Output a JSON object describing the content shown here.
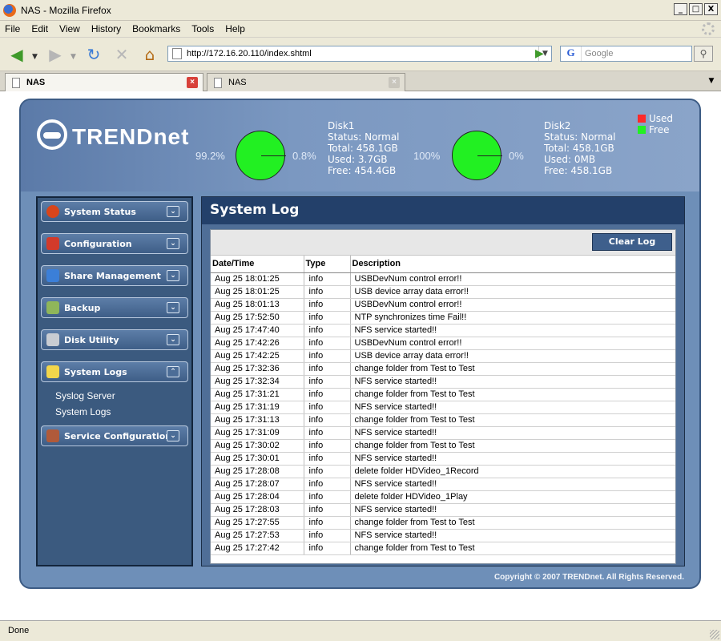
{
  "window": {
    "title": "NAS - Mozilla Firefox",
    "min": "_",
    "max": "□",
    "close": "X"
  },
  "menu": [
    "File",
    "Edit",
    "View",
    "History",
    "Bookmarks",
    "Tools",
    "Help"
  ],
  "nav": {
    "url": "http://172.16.20.110/index.shtml",
    "search_placeholder": "Google",
    "search_engine_letter": "G"
  },
  "tabs": [
    {
      "label": "NAS"
    },
    {
      "label": "NAS"
    }
  ],
  "brand": {
    "logo": "TRENDnet"
  },
  "disks": [
    {
      "name": "Disk1",
      "status": "Status: Normal",
      "total": "Total: 458.1GB",
      "used": "Used: 3.7GB",
      "free": "Free: 454.4GB",
      "free_pct": "99.2%",
      "used_pct": "0.8%"
    },
    {
      "name": "Disk2",
      "status": "Status: Normal",
      "total": "Total: 458.1GB",
      "used": "Used: 0MB",
      "free": "Free: 458.1GB",
      "free_pct": "100%",
      "used_pct": "0%"
    }
  ],
  "legend": {
    "used": "Used",
    "free": "Free",
    "used_color": "#ff2a2a",
    "free_color": "#22f022"
  },
  "sidebar": {
    "items": [
      {
        "label": "System Status"
      },
      {
        "label": "Configuration"
      },
      {
        "label": "Share Management"
      },
      {
        "label": "Backup"
      },
      {
        "label": "Disk Utility"
      },
      {
        "label": "System Logs"
      },
      {
        "label": "Service Configuration"
      }
    ],
    "sub_items": [
      {
        "label": "Syslog Server"
      },
      {
        "label": "System Logs"
      }
    ]
  },
  "main": {
    "title": "System Log",
    "clear_button": "Clear Log",
    "columns": [
      "Date/Time",
      "Type",
      "Description"
    ],
    "rows": [
      [
        "Aug 25 18:01:25",
        "info",
        "USBDevNum control error!!"
      ],
      [
        "Aug 25 18:01:25",
        "info",
        "USB device array data error!!"
      ],
      [
        "Aug 25 18:01:13",
        "info",
        "USBDevNum control error!!"
      ],
      [
        "Aug 25 17:52:50",
        "info",
        "NTP synchronizes time Fail!!"
      ],
      [
        "Aug 25 17:47:40",
        "info",
        "NFS service started!!"
      ],
      [
        "Aug 25 17:42:26",
        "info",
        "USBDevNum control error!!"
      ],
      [
        "Aug 25 17:42:25",
        "info",
        "USB device array data error!!"
      ],
      [
        "Aug 25 17:32:36",
        "info",
        "change folder from Test to Test"
      ],
      [
        "Aug 25 17:32:34",
        "info",
        "NFS service started!!"
      ],
      [
        "Aug 25 17:31:21",
        "info",
        "change folder from Test to Test"
      ],
      [
        "Aug 25 17:31:19",
        "info",
        "NFS service started!!"
      ],
      [
        "Aug 25 17:31:13",
        "info",
        "change folder from Test to Test"
      ],
      [
        "Aug 25 17:31:09",
        "info",
        "NFS service started!!"
      ],
      [
        "Aug 25 17:30:02",
        "info",
        "change folder from Test to Test"
      ],
      [
        "Aug 25 17:30:01",
        "info",
        "NFS service started!!"
      ],
      [
        "Aug 25 17:28:08",
        "info",
        "delete folder HDVideo_1Record"
      ],
      [
        "Aug 25 17:28:07",
        "info",
        "NFS service started!!"
      ],
      [
        "Aug 25 17:28:04",
        "info",
        "delete folder HDVideo_1Play"
      ],
      [
        "Aug 25 17:28:03",
        "info",
        "NFS service started!!"
      ],
      [
        "Aug 25 17:27:55",
        "info",
        "change folder from Test to Test"
      ],
      [
        "Aug 25 17:27:53",
        "info",
        "NFS service started!!"
      ],
      [
        "Aug 25 17:27:42",
        "info",
        "change folder from Test to Test"
      ]
    ]
  },
  "footer": {
    "copyright": "Copyright © 2007 TRENDnet. All Rights Reserved."
  },
  "status": {
    "text": "Done"
  }
}
